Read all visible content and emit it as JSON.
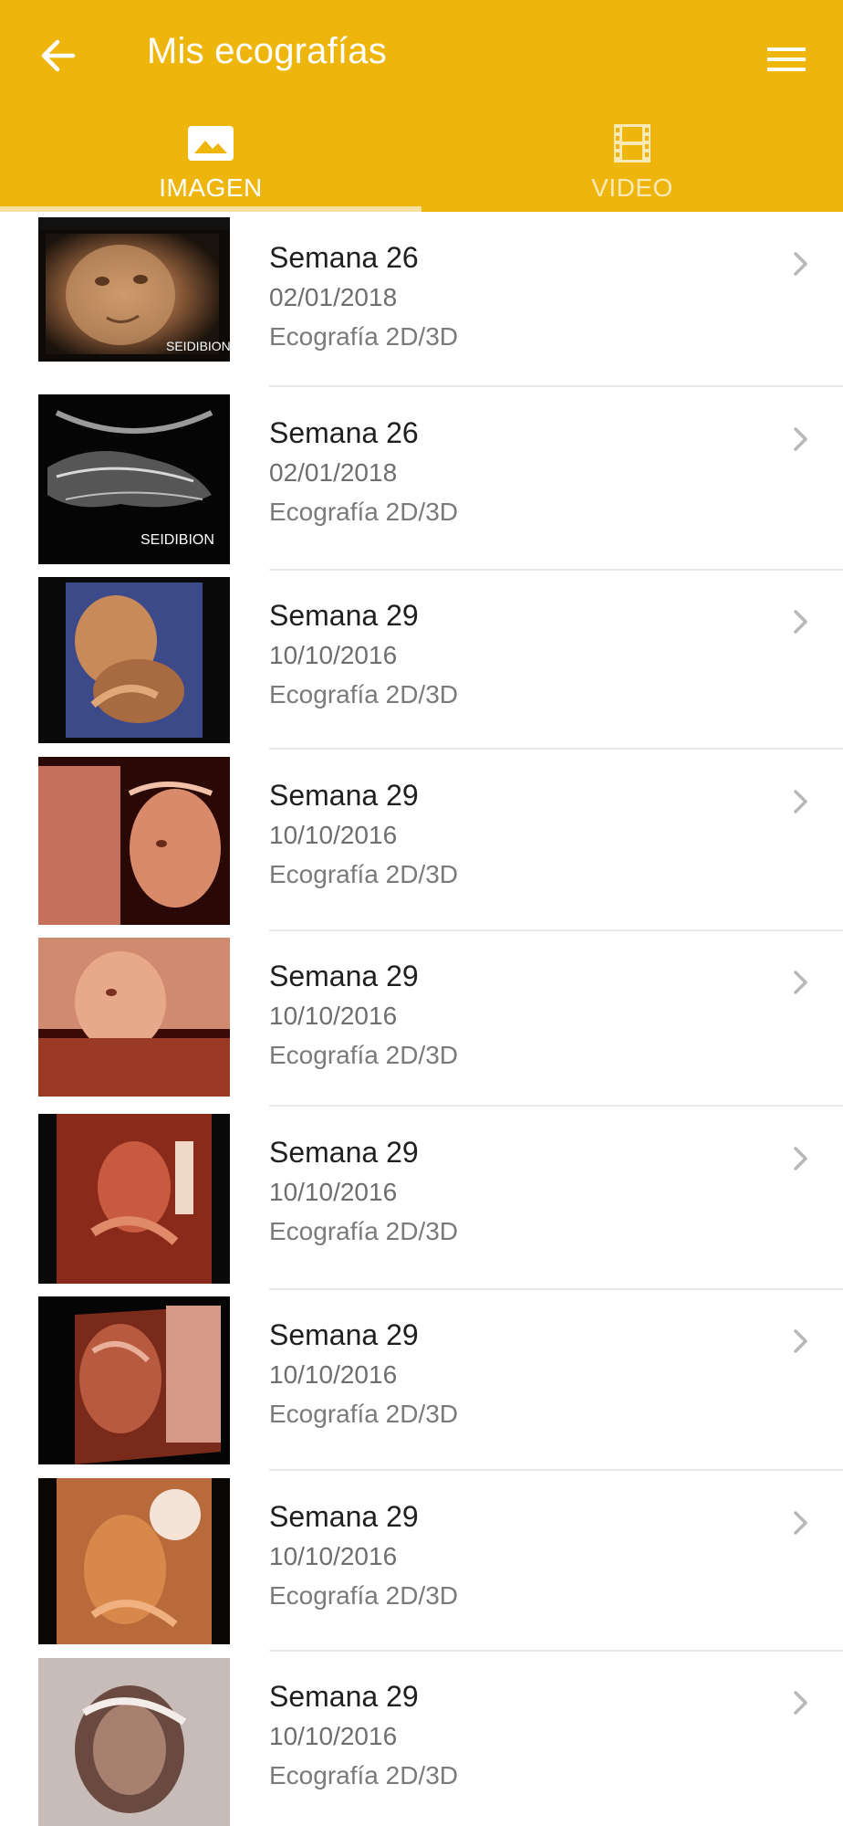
{
  "header": {
    "title": "Mis ecografías",
    "background": "#eeb60c",
    "back_icon": "arrow-left-icon",
    "menu_icon": "hamburger-menu-icon"
  },
  "tabs": [
    {
      "label": "IMAGEN",
      "icon": "image-icon",
      "active": true
    },
    {
      "label": "VIDEO",
      "icon": "film-icon",
      "active": false
    }
  ],
  "items": [
    {
      "title": "Semana 26",
      "date": "02/01/2018",
      "type": "Ecografía 2D/3D",
      "thumb": "3d-face-sepia",
      "watermark": "SEIDIBION"
    },
    {
      "title": "Semana 26",
      "date": "02/01/2018",
      "type": "Ecografía 2D/3D",
      "thumb": "2d-grayscale",
      "watermark": "SEIDIBION"
    },
    {
      "title": "Semana 29",
      "date": "10/10/2016",
      "type": "Ecografía 2D/3D",
      "thumb": "3d-blue-background"
    },
    {
      "title": "Semana 29",
      "date": "10/10/2016",
      "type": "Ecografía 2D/3D",
      "thumb": "3d-red-profile"
    },
    {
      "title": "Semana 29",
      "date": "10/10/2016",
      "type": "Ecografía 2D/3D",
      "thumb": "3d-red-closeup"
    },
    {
      "title": "Semana 29",
      "date": "10/10/2016",
      "type": "Ecografía 2D/3D",
      "thumb": "3d-red-body"
    },
    {
      "title": "Semana 29",
      "date": "10/10/2016",
      "type": "Ecografía 2D/3D",
      "thumb": "3d-red-side"
    },
    {
      "title": "Semana 29",
      "date": "10/10/2016",
      "type": "Ecografía 2D/3D",
      "thumb": "3d-orange-curled"
    },
    {
      "title": "Semana 29",
      "date": "10/10/2016",
      "type": "Ecografía 2D/3D",
      "thumb": "3d-pale-curled"
    }
  ]
}
